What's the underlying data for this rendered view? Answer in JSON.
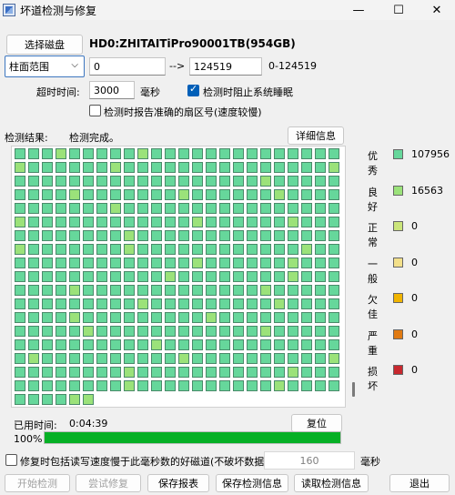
{
  "window": {
    "title": "坏道检测与修复",
    "minimize_glyph": "—",
    "maximize_glyph": "☐",
    "close_glyph": "✕"
  },
  "disk": {
    "select_button": "选择磁盘",
    "name": "HD0:ZHITAITiPro90001TB(954GB)"
  },
  "range": {
    "mode": "柱面范围",
    "start": "0",
    "arrow": "-->",
    "end": "124519",
    "span": "0-124519"
  },
  "timeout": {
    "label": "超时时间:",
    "value": "3000",
    "unit": "毫秒"
  },
  "options": {
    "prevent_sleep": "检测时阻止系统睡眠",
    "prevent_sleep_checked": true,
    "report_sector": "检测时报告准确的扇区号(速度较慢)",
    "report_sector_checked": false
  },
  "results": {
    "label": "检测结果:",
    "status": "检测完成。",
    "details_button": "详细信息"
  },
  "grid": {
    "columns": 24,
    "rows": 19,
    "last_row_count": 6,
    "good_color": "#6fdc9e",
    "good_fill": "#66d79b",
    "ok_color": "#9be27a",
    "ok_positions": [
      3,
      9,
      24,
      31,
      47,
      66,
      76,
      84,
      91,
      103,
      120,
      133,
      140,
      152,
      168,
      176,
      189,
      205,
      212,
      227,
      236,
      244,
      258,
      273,
      283,
      292,
      302,
      317,
      330,
      346,
      361,
      372,
      383,
      392,
      404,
      416,
      427,
      437,
      442,
      436
    ]
  },
  "legend": [
    {
      "label": "优秀",
      "color": "#66d79b",
      "count": "107956"
    },
    {
      "label": "良好",
      "color": "#9be27a",
      "count": "16563"
    },
    {
      "label": "正常",
      "color": "#cbe57a",
      "count": "0"
    },
    {
      "label": "一般",
      "color": "#f3e08a",
      "count": "0"
    },
    {
      "label": "欠佳",
      "color": "#f0b400",
      "count": "0"
    },
    {
      "label": "严重",
      "color": "#e07a12",
      "count": "0"
    },
    {
      "label": "损坏",
      "color": "#c8282e",
      "count": "0"
    }
  ],
  "elapsed": {
    "label": "已用时间:",
    "value": "0:04:39",
    "reset_button": "复位"
  },
  "progress": {
    "percent_label": "100%",
    "fraction": 1.0
  },
  "repair": {
    "label": "修复时包括读写速度慢于此毫秒数的好磁道(不破坏数据):",
    "value": "160",
    "unit": "毫秒",
    "checked": false
  },
  "buttons": {
    "start": "开始检测",
    "try_repair": "尝试修复",
    "save_report": "保存报表",
    "save_result": "保存检测信息",
    "load_result": "读取检测信息",
    "exit": "退出"
  }
}
